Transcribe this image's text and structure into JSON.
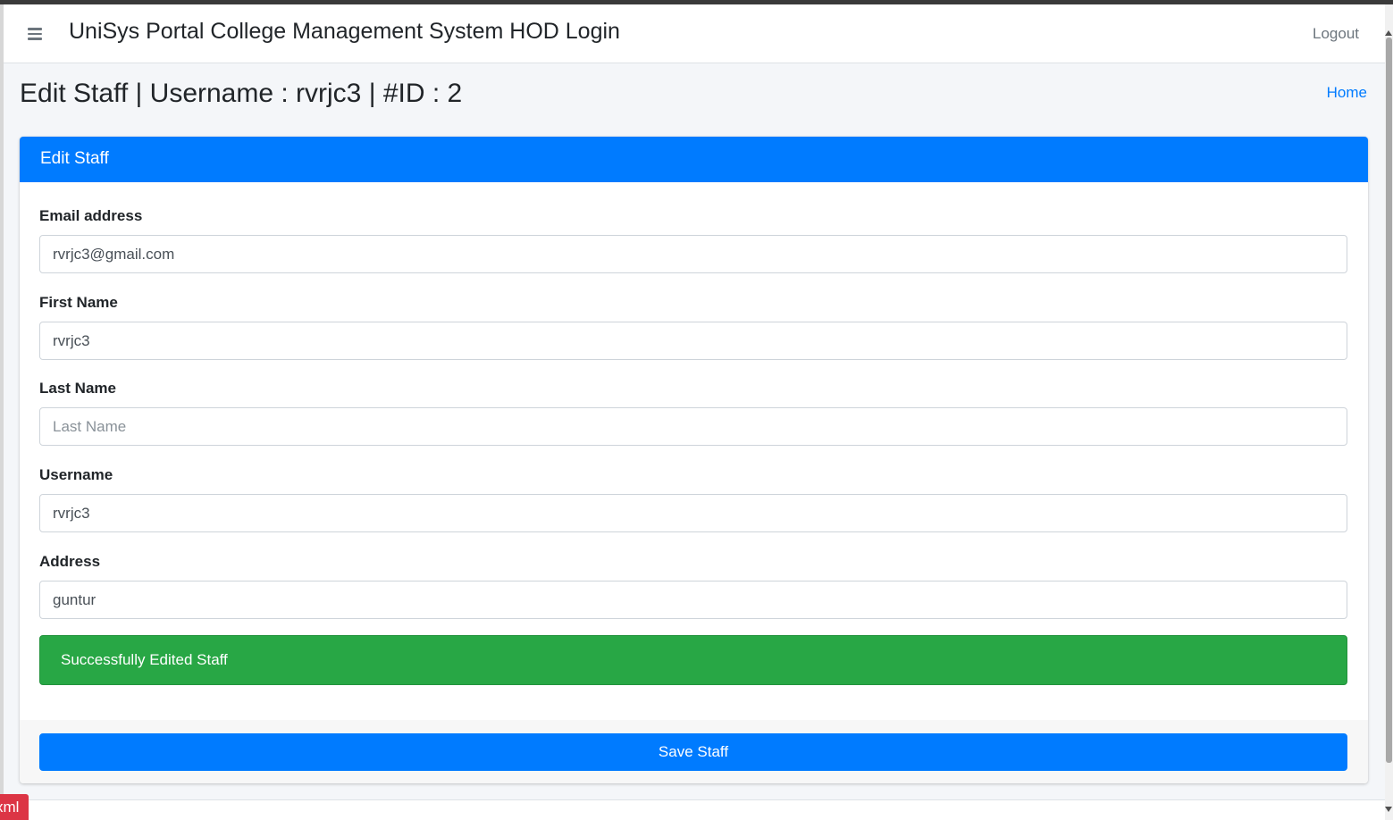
{
  "navbar": {
    "menu_icon": "hamburger-menu-icon",
    "title": "UniSys Portal College Management System HOD Login",
    "logout_label": "Logout"
  },
  "page": {
    "title": "Edit Staff | Username : rvrjc3 | #ID : 2",
    "breadcrumb_home": "Home"
  },
  "card": {
    "header": "Edit Staff",
    "fields": {
      "email": {
        "label": "Email address",
        "value": "rvrjc3@gmail.com",
        "placeholder": ""
      },
      "first_name": {
        "label": "First Name",
        "value": "rvrjc3",
        "placeholder": ""
      },
      "last_name": {
        "label": "Last Name",
        "value": "",
        "placeholder": "Last Name"
      },
      "username": {
        "label": "Username",
        "value": "rvrjc3",
        "placeholder": ""
      },
      "address": {
        "label": "Address",
        "value": "guntur",
        "placeholder": ""
      }
    },
    "alert": "Successfully Edited Staff",
    "save_label": "Save Staff"
  },
  "debug_badge": "xml",
  "colors": {
    "primary": "#007bff",
    "success": "#28a745",
    "page_bg": "#f4f6f9",
    "debug": "#dc3545"
  }
}
